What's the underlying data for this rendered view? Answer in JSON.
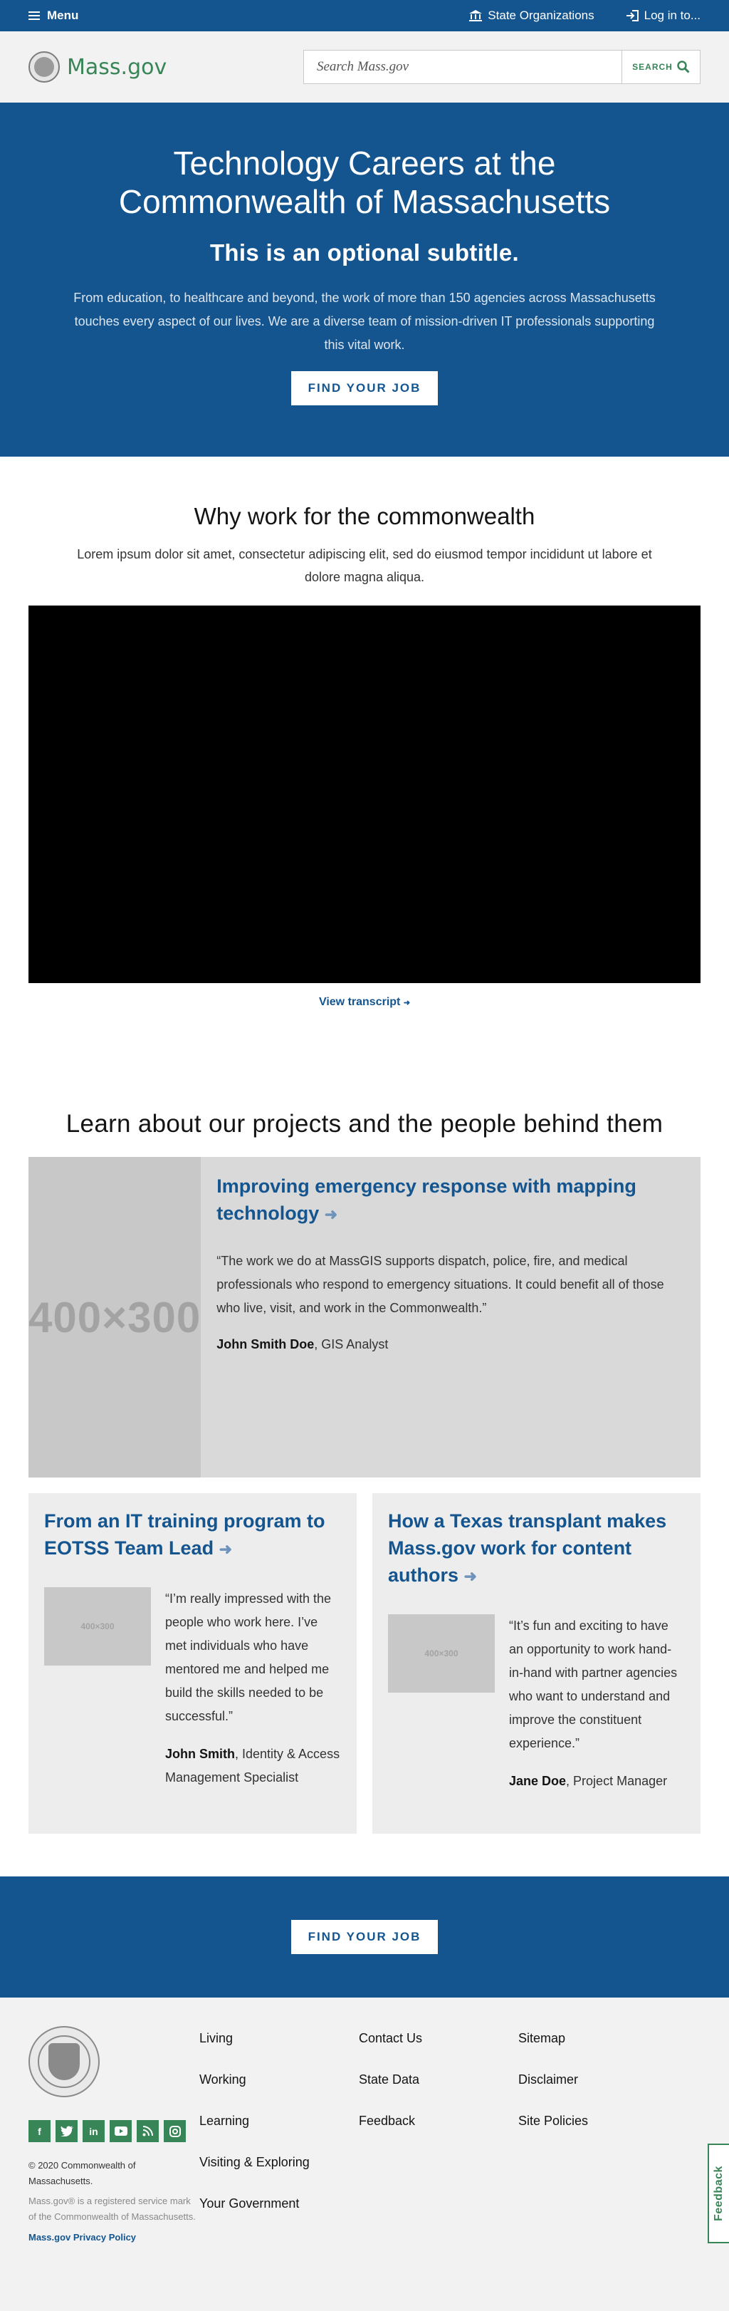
{
  "util_nav": {
    "menu_label": "Menu",
    "state_orgs": "State Organizations",
    "login": "Log in to..."
  },
  "header": {
    "logo_text": "Mass.gov",
    "search_placeholder": "Search Mass.gov",
    "search_button": "SEARCH"
  },
  "hero": {
    "title": "Technology Careers at the Commonwealth of Massachusetts",
    "subtitle": "This is an optional subtitle.",
    "description": "From education, to healthcare and beyond, the work of more than 150 agencies across Massachusetts touches every aspect of our lives. We are a diverse team of mission-driven IT professionals supporting this vital work.",
    "button": "FIND YOUR JOB"
  },
  "why": {
    "title": "Why work for the commonwealth",
    "text": "Lorem ipsum dolor sit amet, consectetur adipiscing elit, sed do eiusmod tempor incididunt ut labore et dolore magna aliqua.",
    "transcript_link": "View transcript"
  },
  "learn": {
    "title": "Learn about our projects and the people behind them",
    "feature": {
      "image_label": "400×300",
      "title": "Improving emergency response with mapping technology",
      "quote": "“The work we do at MassGIS supports dispatch, police, fire, and medical professionals who respond to emergency situations. It could benefit all of those who live, visit, and work in the Commonwealth.”",
      "name": "John Smith Doe",
      "role": ", GIS Analyst"
    },
    "cards": [
      {
        "title": "From an IT training program to EOTSS Team Lead",
        "image_label": "400×300",
        "quote": "“I’m really impressed with the people who work here. I’ve met individuals who have mentored me and helped me build the skills needed to be successful.”",
        "name": "John Smith",
        "role": ", Identity & Access Management Specialist"
      },
      {
        "title": "How a Texas transplant makes Mass.gov work for content authors",
        "image_label": "400×300",
        "quote": "“It’s fun and exciting to have an opportunity to work hand-in-hand with partner agencies who want to understand and improve the constituent experience.”",
        "name": "Jane Doe",
        "role": ", Project Manager"
      }
    ]
  },
  "cta": {
    "button": "FIND YOUR JOB"
  },
  "footer": {
    "copyright": "© 2020 Commonwealth of Massachusetts.",
    "trademark": "Mass.gov® is a registered service mark of the Commonwealth of Massachusetts.",
    "privacy": "Mass.gov Privacy Policy",
    "col1": [
      "Living",
      "Working",
      "Learning",
      "Visiting & Exploring",
      "Your Government"
    ],
    "col2": [
      "Contact Us",
      "State Data",
      "Feedback"
    ],
    "col3": [
      "Sitemap",
      "Disclaimer",
      "Site Policies"
    ],
    "feedback_tab": "Feedback",
    "socials": [
      "facebook-icon",
      "twitter-icon",
      "linkedin-icon",
      "youtube-icon",
      "rss-icon",
      "instagram-icon"
    ]
  },
  "colors": {
    "brand_blue": "#14558f",
    "brand_green": "#388557"
  }
}
